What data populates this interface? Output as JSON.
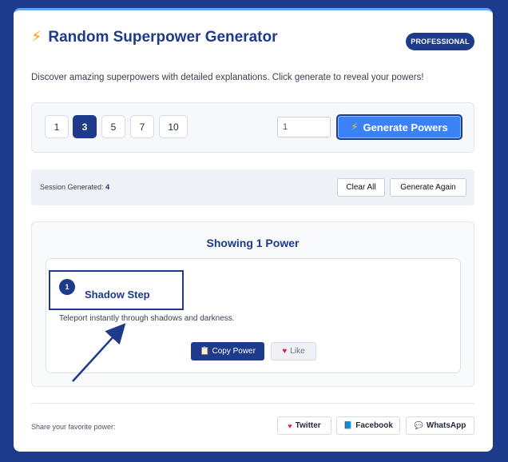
{
  "header": {
    "bolt_glyph": "⚡",
    "title": "Random Superpower Generator",
    "badge": "PROFESSIONAL",
    "subtitle": "Discover amazing superpowers with detailed explanations. Click generate to reveal your powers!"
  },
  "controls": {
    "quick_counts": [
      "1",
      "3",
      "5",
      "7",
      "10"
    ],
    "active_count": "3",
    "count_input_value": "1",
    "generate_label": "Generate Powers",
    "generate_icon": "⚡"
  },
  "session": {
    "label": "Session Generated:",
    "count": "4",
    "clear_label": "Clear All",
    "again_label": "Generate Again"
  },
  "results": {
    "title": "Showing 1 Power",
    "powers": [
      {
        "number": "1",
        "name": "Shadow Step",
        "description": "Teleport instantly through shadows and darkness.",
        "copy_label": "Copy Power",
        "copy_icon": "📋",
        "like_label": "Like",
        "like_icon": "♥"
      }
    ]
  },
  "share": {
    "label": "Share your favorite power:",
    "buttons": [
      {
        "label": "Twitter",
        "icon": "♥"
      },
      {
        "label": "Facebook",
        "icon": "📘"
      },
      {
        "label": "WhatsApp",
        "icon": "💬"
      }
    ]
  },
  "colors": {
    "background": "#1e3a8a",
    "accent": "#3b82f6",
    "brand": "#1e3a8a",
    "like": "#e11d48"
  }
}
